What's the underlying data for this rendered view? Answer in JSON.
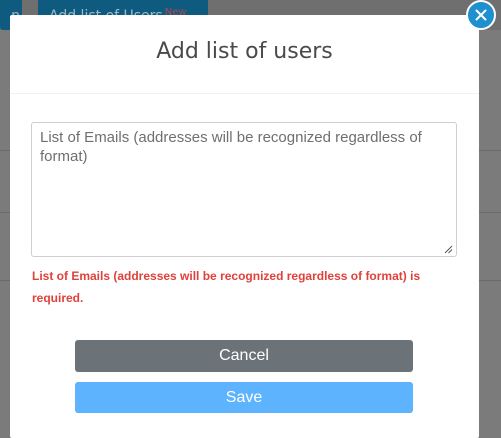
{
  "background": {
    "left_button_label": "n",
    "right_button_label": "Add list of Users",
    "right_button_badge": "New"
  },
  "modal": {
    "title": "Add list of users",
    "textarea": {
      "placeholder": "List of Emails (addresses will be recognized regardless of format)",
      "value": ""
    },
    "error": "List of Emails (addresses will be recognized regardless of format) is required.",
    "cancel_label": "Cancel",
    "save_label": "Save",
    "close_icon": "close-icon"
  },
  "colors": {
    "accent": "#1f8fd0",
    "save": "#5eb3ff",
    "cancel": "#6c7378",
    "error": "#e0413a"
  }
}
